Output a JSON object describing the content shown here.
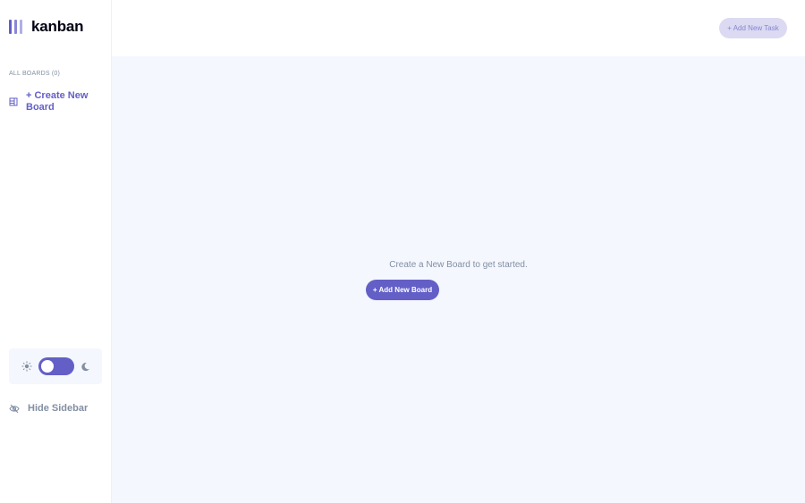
{
  "app": {
    "logo_text": "kanban"
  },
  "sidebar": {
    "boards_heading": "ALL BOARDS (0)",
    "create_board_label": "+ Create New Board",
    "hide_sidebar_label": "Hide Sidebar",
    "theme_toggle": {
      "state": "light"
    }
  },
  "header": {
    "add_task_label": "+ Add New Task"
  },
  "main": {
    "empty_message": "Create a New Board to get started.",
    "add_board_label": "+ Add New Board"
  },
  "colors": {
    "accent": "#635fc7",
    "accent_light": "#d8d7f1",
    "background": "#f4f7fd",
    "muted_text": "#828fa3"
  },
  "icons": [
    "logo-bars-icon",
    "board-icon",
    "sun-icon",
    "moon-icon",
    "eye-slash-icon"
  ]
}
